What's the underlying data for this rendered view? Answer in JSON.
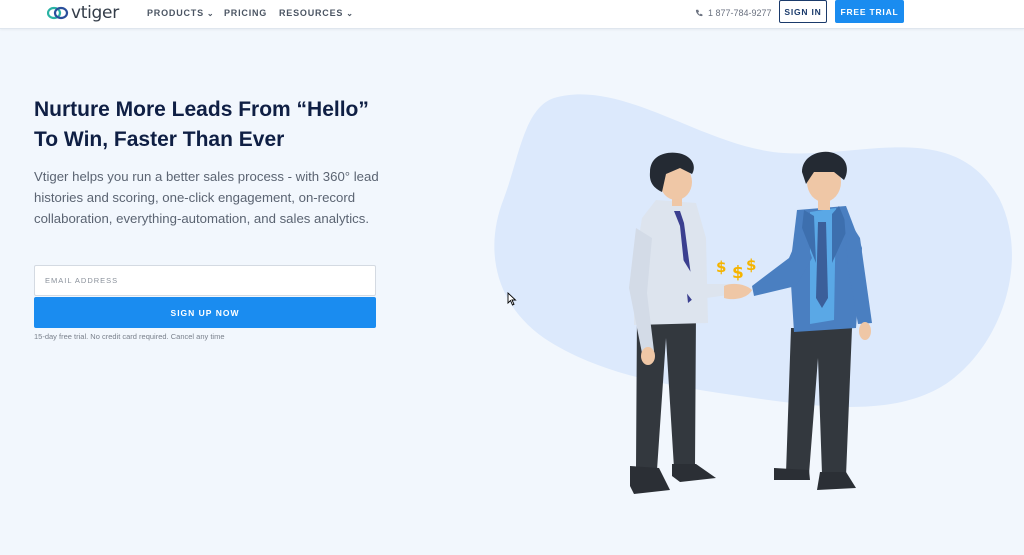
{
  "brand": {
    "name": "vtiger"
  },
  "nav": {
    "items": [
      {
        "label": "PRODUCTS",
        "has_dropdown": true
      },
      {
        "label": "PRICING",
        "has_dropdown": false
      },
      {
        "label": "RESOURCES",
        "has_dropdown": true
      }
    ],
    "phone": "1 877-784-9277",
    "sign_in": "SIGN IN",
    "free_trial": "FREE TRIAL"
  },
  "hero": {
    "title_line1": "Nurture More Leads From “Hello”",
    "title_line2": "To Win, Faster Than Ever",
    "description": "Vtiger helps you run a better sales process - with 360° lead histories and scoring, one-click engagement, on-record collaboration, everything-automation, and sales analytics.",
    "email_placeholder": "EMAIL ADDRESS",
    "signup_button": "SIGN UP NOW",
    "trial_note": "15-day free trial. No credit card required. Cancel any time"
  },
  "illustration": {
    "dollar_signs": [
      "$",
      "$",
      "$"
    ]
  },
  "colors": {
    "accent": "#1a8cf0",
    "heading": "#0f1f44",
    "background": "#f2f7fd",
    "blob": "#dce9fc"
  },
  "icons": [
    "phone-icon",
    "chevron-down-icon",
    "vtiger-logo-icon",
    "mouse-cursor-icon"
  ]
}
